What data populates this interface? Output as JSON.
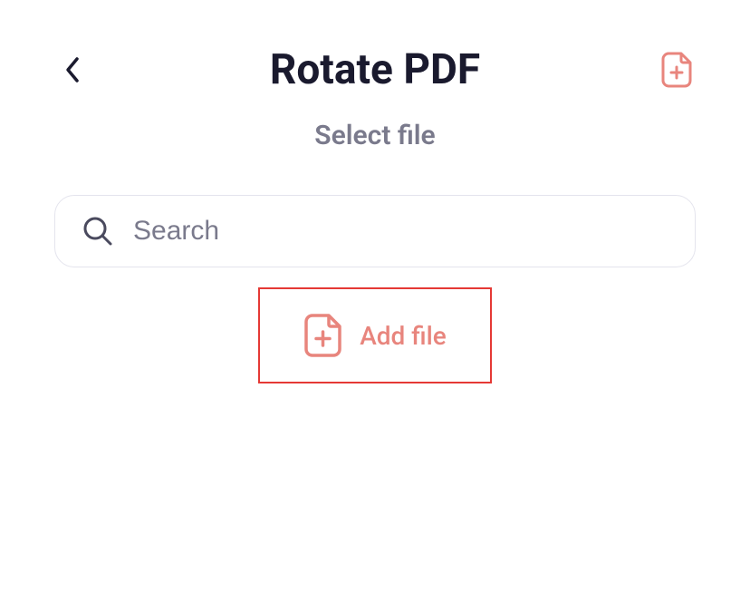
{
  "header": {
    "title": "Rotate PDF"
  },
  "subtitle": "Select file",
  "search": {
    "placeholder": "Search"
  },
  "add_file": {
    "label": "Add file"
  },
  "colors": {
    "accent": "#e8857d",
    "highlight_border": "#e53935",
    "text_dark": "#1a1a2e",
    "text_muted": "#7a7a8c"
  }
}
